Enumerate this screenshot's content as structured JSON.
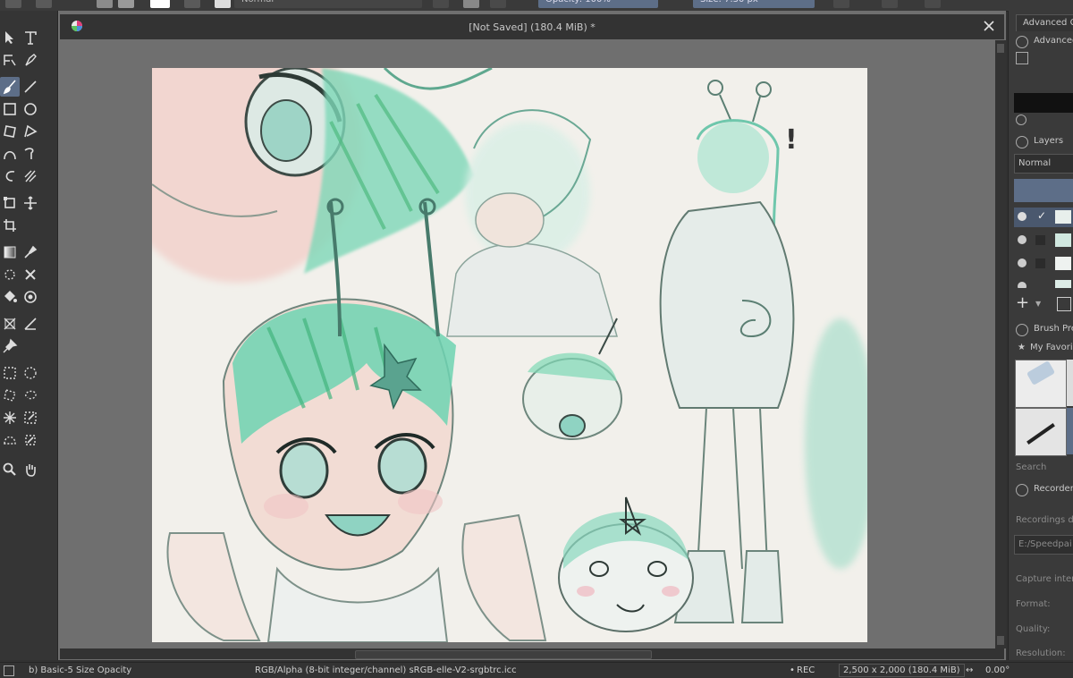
{
  "toolbar": {
    "blend_mode": "Normal",
    "opacity": "Opacity: 100%",
    "size": "Size: 7.30 px"
  },
  "document": {
    "title": "[Not Saved]  (180.4 MiB) *"
  },
  "dock": {
    "advanced_color_tab": "Advanced C",
    "advanced_color_title": "Advanced",
    "layers_title": "Layers",
    "layers_blend": "Normal",
    "brush_presets_title": "Brush Pre",
    "favorites_tag": "My Favori",
    "search_placeholder": "Search",
    "recorder_title": "Recorder",
    "recordings_dir_label": "Recordings d",
    "recordings_dir_value": "E:/Speedpai",
    "capture_label": "Capture inter",
    "format_label": "Format:",
    "quality_label": "Quality:",
    "resolution_label": "Resolution:"
  },
  "status": {
    "brush": "b) Basic-5 Size Opacity",
    "color_space": "RGB/Alpha (8-bit integer/channel)  sRGB-elle-V2-srgbtrc.icc",
    "rec": "REC",
    "image_size": "2,500 x 2,000 (180.4 MiB)",
    "rotation": "0.00°"
  },
  "icons": {
    "close": "close-icon",
    "krita_logo": "krita-logo-icon"
  }
}
